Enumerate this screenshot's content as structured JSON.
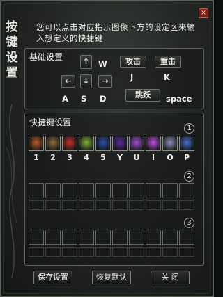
{
  "window": {
    "title": "按键设置",
    "close_label": "×",
    "description": "您可以点击对应指示图像下方的设定区来输入想定义的快捷键"
  },
  "basic": {
    "label": "基础设置",
    "keys": {
      "up": "↑",
      "down": "↓",
      "left": "←",
      "right": "→",
      "w": "W",
      "a": "A",
      "s": "S",
      "d": "D",
      "attack": "攻击",
      "heavy": "重击",
      "jump": "跳跃",
      "j": "J",
      "k": "K",
      "space": "space"
    }
  },
  "quick": {
    "label": "快捷键设置",
    "rows": [
      {
        "num": "1",
        "keys": [
          "1",
          "2",
          "3",
          "4",
          "5",
          "Y",
          "U",
          "I",
          "O",
          "P"
        ]
      },
      {
        "num": "2",
        "keys": [
          "",
          "",
          "",
          "",
          "",
          "",
          "",
          "",
          "",
          ""
        ]
      },
      {
        "num": "3",
        "keys": [
          "",
          "",
          "",
          "",
          "",
          "",
          "",
          "",
          "",
          ""
        ]
      }
    ],
    "icon_names": [
      "sword-skill-icon",
      "punch-skill-icon",
      "fire-blade-icon",
      "poison-skill-icon",
      "lightning-skill-icon",
      "void-orb-icon",
      "purple-burst-icon",
      "arcane-blast-icon",
      "ghost-skill-icon",
      "ice-wing-icon"
    ],
    "icon_colors": [
      "#b35a2a",
      "#8c6b3d",
      "#c2312a",
      "#7fb03a",
      "#2a4fa8",
      "#5a2a9c",
      "#a14fd1",
      "#c050e0",
      "#8d8fb5",
      "#4a6fc8"
    ]
  },
  "buttons": {
    "save": "保存设置",
    "restore": "恢复默认",
    "close": "关 闭"
  }
}
